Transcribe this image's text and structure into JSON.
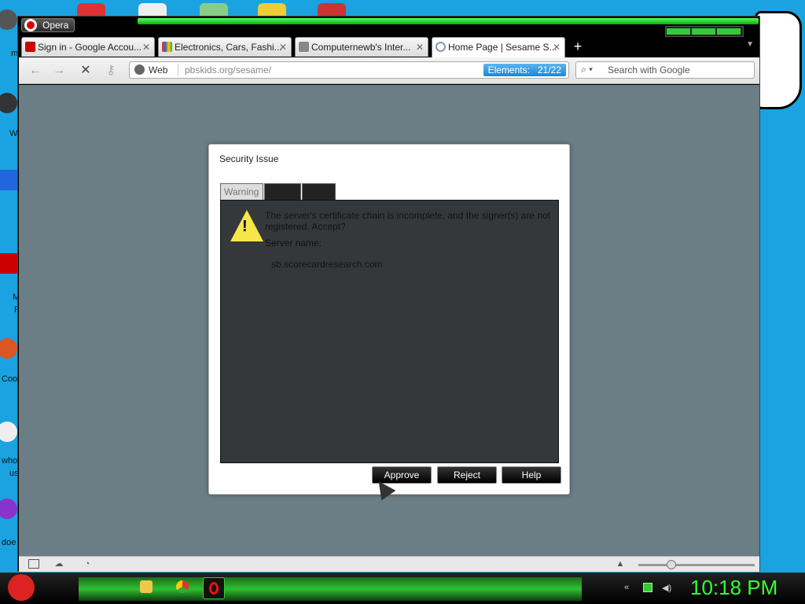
{
  "desktop": {
    "icon_labels": [
      "m",
      "W",
      "M",
      "F",
      "Coo",
      "who",
      "us",
      "doe"
    ]
  },
  "browser": {
    "app_name": "Opera",
    "tabs": [
      {
        "title": "Sign in - Google Accou...",
        "active": false
      },
      {
        "title": "Electronics, Cars, Fashi...",
        "active": false
      },
      {
        "title": "Computernewb's Inter...",
        "active": false
      },
      {
        "title": "Home Page | Sesame S...",
        "active": true
      }
    ],
    "new_tab_label": "+",
    "web_badge": "Web",
    "url": "pbskids.org/sesame/",
    "elements_label": "Elements:",
    "elements_count": "21/22",
    "search_placeholder": "Search with Google"
  },
  "dialog": {
    "title": "Security Issue",
    "tabs": [
      "Warning",
      "",
      ""
    ],
    "message": "The server's certificate chain is incomplete, and the signer(s) are not registered. Accept?",
    "server_name_label": "Server name:",
    "server_name": "sb.scorecardresearch.com",
    "buttons": {
      "approve": "Approve",
      "reject": "Reject",
      "help": "Help"
    }
  },
  "taskbar": {
    "clock": "10:18 PM"
  },
  "colors": {
    "desktop": "#1aa3e0",
    "content_bg": "#6b7e85",
    "clock": "#33ff33",
    "accent_green": "#2fbf2f"
  }
}
